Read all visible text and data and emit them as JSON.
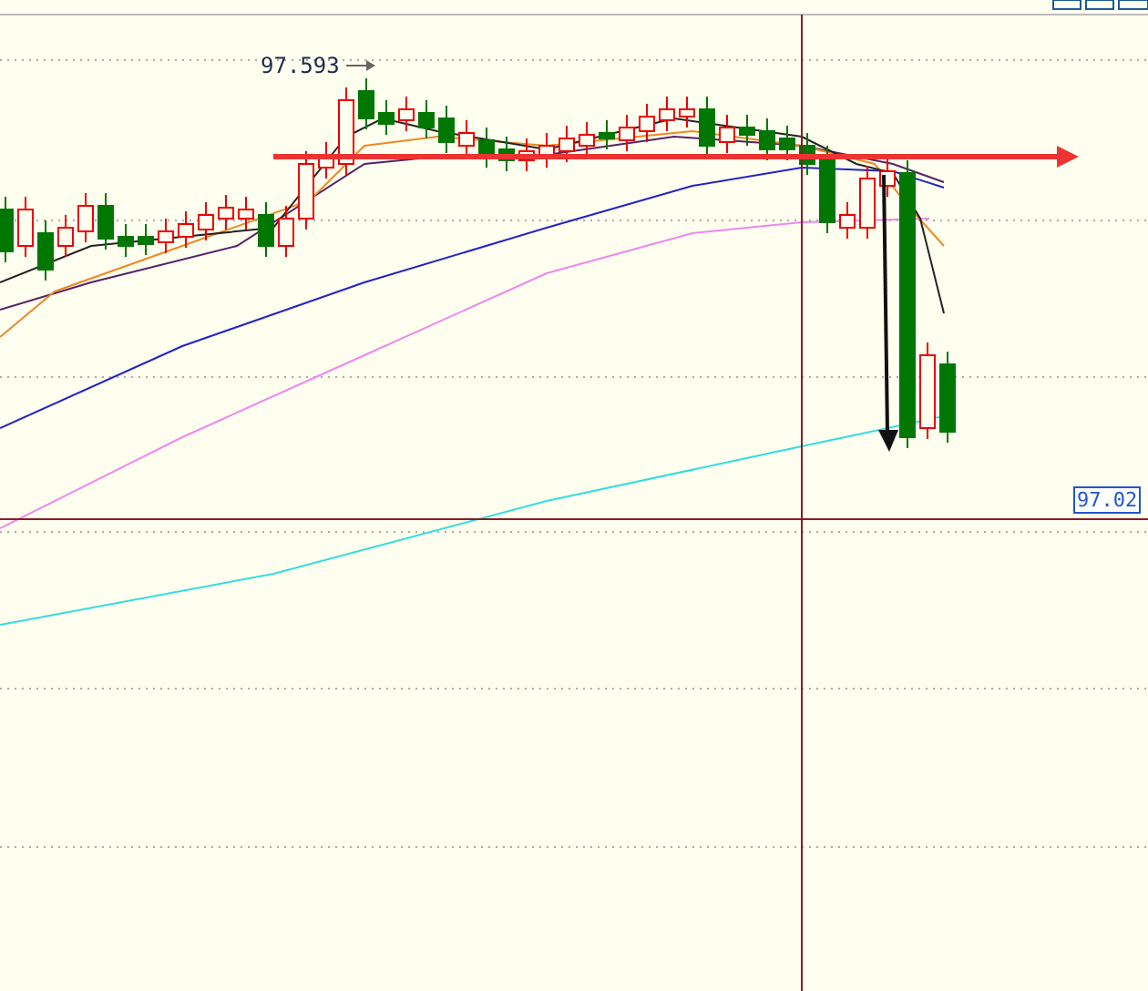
{
  "chart": {
    "high_label": "97.593",
    "price_label": "97.02"
  }
}
